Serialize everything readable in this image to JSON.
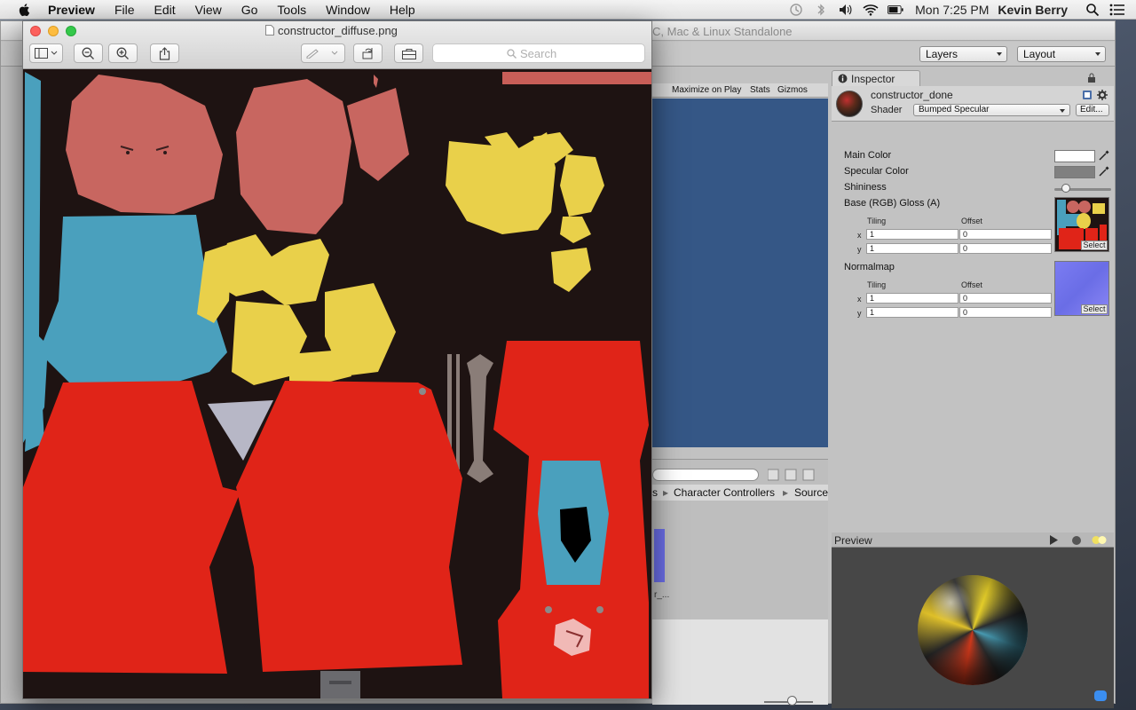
{
  "menubar": {
    "app_name": "Preview",
    "items": [
      "File",
      "Edit",
      "View",
      "Go",
      "Tools",
      "Window",
      "Help"
    ],
    "clock": "Mon 7:25 PM",
    "user": "Kevin Berry"
  },
  "unity": {
    "window_title": "C, Mac & Linux Standalone",
    "layers_label": "Layers",
    "layout_label": "Layout",
    "gameview": {
      "maximize_label": "Maximize on Play",
      "stats_label": "Stats",
      "gizmos_label": "Gizmos"
    },
    "project": {
      "crumb_1": "s",
      "crumb_2": "Character Controllers",
      "crumb_3": "Source",
      "thumb_caption": "r_..."
    },
    "inspector": {
      "tab_label": "Inspector",
      "object_name": "constructor_done",
      "shader_label": "Shader",
      "shader_value": "Bumped Specular",
      "edit_label": "Edit...",
      "main_color_label": "Main Color",
      "specular_color_label": "Specular Color",
      "shininess_label": "Shininess",
      "shininess_value": 0.2,
      "base_label": "Base (RGB) Gloss (A)",
      "normalmap_label": "Normalmap",
      "tiling_label": "Tiling",
      "offset_label": "Offset",
      "x_label": "x",
      "y_label": "y",
      "base_tiling_x": "1",
      "base_tiling_y": "1",
      "base_offset_x": "0",
      "base_offset_y": "0",
      "normal_tiling_x": "1",
      "normal_tiling_y": "1",
      "normal_offset_x": "0",
      "normal_offset_y": "0",
      "select_label": "Select",
      "main_color": "#ffffff",
      "specular_color": "#808080"
    },
    "preview": {
      "label": "Preview"
    }
  },
  "preview_app": {
    "document_title": "constructor_diffuse.png",
    "search_placeholder": "Search"
  },
  "colors": {
    "texture_background": "#1e1312",
    "skin": "#c86660",
    "cloth_blue": "#4aa0bd",
    "cloth_yellow": "#e9d04a",
    "cloth_red": "#e02418",
    "gameview_blue": "#355786"
  }
}
